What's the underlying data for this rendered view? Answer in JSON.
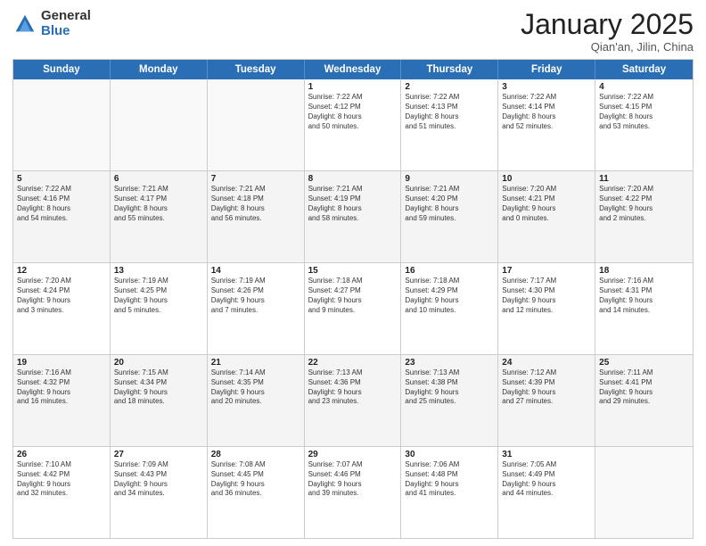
{
  "logo": {
    "general": "General",
    "blue": "Blue"
  },
  "header": {
    "title": "January 2025",
    "subtitle": "Qian'an, Jilin, China"
  },
  "days_of_week": [
    "Sunday",
    "Monday",
    "Tuesday",
    "Wednesday",
    "Thursday",
    "Friday",
    "Saturday"
  ],
  "weeks": [
    [
      {
        "day": "",
        "info": ""
      },
      {
        "day": "",
        "info": ""
      },
      {
        "day": "",
        "info": ""
      },
      {
        "day": "1",
        "info": "Sunrise: 7:22 AM\nSunset: 4:12 PM\nDaylight: 8 hours\nand 50 minutes."
      },
      {
        "day": "2",
        "info": "Sunrise: 7:22 AM\nSunset: 4:13 PM\nDaylight: 8 hours\nand 51 minutes."
      },
      {
        "day": "3",
        "info": "Sunrise: 7:22 AM\nSunset: 4:14 PM\nDaylight: 8 hours\nand 52 minutes."
      },
      {
        "day": "4",
        "info": "Sunrise: 7:22 AM\nSunset: 4:15 PM\nDaylight: 8 hours\nand 53 minutes."
      }
    ],
    [
      {
        "day": "5",
        "info": "Sunrise: 7:22 AM\nSunset: 4:16 PM\nDaylight: 8 hours\nand 54 minutes."
      },
      {
        "day": "6",
        "info": "Sunrise: 7:21 AM\nSunset: 4:17 PM\nDaylight: 8 hours\nand 55 minutes."
      },
      {
        "day": "7",
        "info": "Sunrise: 7:21 AM\nSunset: 4:18 PM\nDaylight: 8 hours\nand 56 minutes."
      },
      {
        "day": "8",
        "info": "Sunrise: 7:21 AM\nSunset: 4:19 PM\nDaylight: 8 hours\nand 58 minutes."
      },
      {
        "day": "9",
        "info": "Sunrise: 7:21 AM\nSunset: 4:20 PM\nDaylight: 8 hours\nand 59 minutes."
      },
      {
        "day": "10",
        "info": "Sunrise: 7:20 AM\nSunset: 4:21 PM\nDaylight: 9 hours\nand 0 minutes."
      },
      {
        "day": "11",
        "info": "Sunrise: 7:20 AM\nSunset: 4:22 PM\nDaylight: 9 hours\nand 2 minutes."
      }
    ],
    [
      {
        "day": "12",
        "info": "Sunrise: 7:20 AM\nSunset: 4:24 PM\nDaylight: 9 hours\nand 3 minutes."
      },
      {
        "day": "13",
        "info": "Sunrise: 7:19 AM\nSunset: 4:25 PM\nDaylight: 9 hours\nand 5 minutes."
      },
      {
        "day": "14",
        "info": "Sunrise: 7:19 AM\nSunset: 4:26 PM\nDaylight: 9 hours\nand 7 minutes."
      },
      {
        "day": "15",
        "info": "Sunrise: 7:18 AM\nSunset: 4:27 PM\nDaylight: 9 hours\nand 9 minutes."
      },
      {
        "day": "16",
        "info": "Sunrise: 7:18 AM\nSunset: 4:29 PM\nDaylight: 9 hours\nand 10 minutes."
      },
      {
        "day": "17",
        "info": "Sunrise: 7:17 AM\nSunset: 4:30 PM\nDaylight: 9 hours\nand 12 minutes."
      },
      {
        "day": "18",
        "info": "Sunrise: 7:16 AM\nSunset: 4:31 PM\nDaylight: 9 hours\nand 14 minutes."
      }
    ],
    [
      {
        "day": "19",
        "info": "Sunrise: 7:16 AM\nSunset: 4:32 PM\nDaylight: 9 hours\nand 16 minutes."
      },
      {
        "day": "20",
        "info": "Sunrise: 7:15 AM\nSunset: 4:34 PM\nDaylight: 9 hours\nand 18 minutes."
      },
      {
        "day": "21",
        "info": "Sunrise: 7:14 AM\nSunset: 4:35 PM\nDaylight: 9 hours\nand 20 minutes."
      },
      {
        "day": "22",
        "info": "Sunrise: 7:13 AM\nSunset: 4:36 PM\nDaylight: 9 hours\nand 23 minutes."
      },
      {
        "day": "23",
        "info": "Sunrise: 7:13 AM\nSunset: 4:38 PM\nDaylight: 9 hours\nand 25 minutes."
      },
      {
        "day": "24",
        "info": "Sunrise: 7:12 AM\nSunset: 4:39 PM\nDaylight: 9 hours\nand 27 minutes."
      },
      {
        "day": "25",
        "info": "Sunrise: 7:11 AM\nSunset: 4:41 PM\nDaylight: 9 hours\nand 29 minutes."
      }
    ],
    [
      {
        "day": "26",
        "info": "Sunrise: 7:10 AM\nSunset: 4:42 PM\nDaylight: 9 hours\nand 32 minutes."
      },
      {
        "day": "27",
        "info": "Sunrise: 7:09 AM\nSunset: 4:43 PM\nDaylight: 9 hours\nand 34 minutes."
      },
      {
        "day": "28",
        "info": "Sunrise: 7:08 AM\nSunset: 4:45 PM\nDaylight: 9 hours\nand 36 minutes."
      },
      {
        "day": "29",
        "info": "Sunrise: 7:07 AM\nSunset: 4:46 PM\nDaylight: 9 hours\nand 39 minutes."
      },
      {
        "day": "30",
        "info": "Sunrise: 7:06 AM\nSunset: 4:48 PM\nDaylight: 9 hours\nand 41 minutes."
      },
      {
        "day": "31",
        "info": "Sunrise: 7:05 AM\nSunset: 4:49 PM\nDaylight: 9 hours\nand 44 minutes."
      },
      {
        "day": "",
        "info": ""
      }
    ]
  ]
}
